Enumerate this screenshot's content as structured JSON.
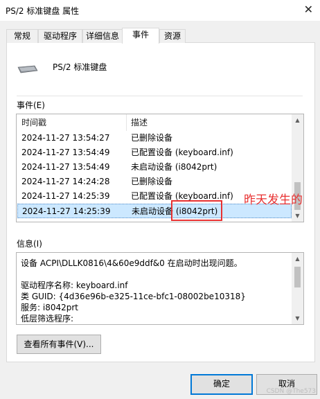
{
  "window": {
    "title": "PS/2 标准键盘 属性",
    "close": "✕"
  },
  "tabs": [
    "常规",
    "驱动程序",
    "详细信息",
    "事件",
    "资源"
  ],
  "device": {
    "name": "PS/2 标准键盘"
  },
  "events": {
    "label": "事件(E)",
    "columns": [
      "时间戳",
      "描述"
    ],
    "rows": [
      {
        "time": "2024-11-27 13:54:27",
        "desc": "已删除设备"
      },
      {
        "time": "2024-11-27 13:54:49",
        "desc": "已配置设备 (keyboard.inf)"
      },
      {
        "time": "2024-11-27 13:54:49",
        "desc": "未启动设备 (i8042prt)"
      },
      {
        "time": "2024-11-27 14:24:28",
        "desc": "已删除设备"
      },
      {
        "time": "2024-11-27 14:25:39",
        "desc": "已配置设备 (keyboard.inf)"
      },
      {
        "time": "2024-11-27 14:25:39",
        "desc": "未启动设备 (i8042prt)"
      }
    ],
    "selected_index": 5
  },
  "annotation": {
    "text": "昨天发生的",
    "color": "#e83131"
  },
  "info": {
    "label": "信息(I)",
    "lines": [
      "设备 ACPI\\DLLK0816\\4&60e9ddf&0 在启动时出现问题。",
      "",
      "驱动程序名称: keyboard.inf",
      "类 GUID: {4d36e96b-e325-11ce-bfc1-08002be10318}",
      "服务: i8042prt",
      "低层筛选程序:"
    ]
  },
  "buttons": {
    "view_all": "查看所有事件(V)...",
    "ok": "确定",
    "cancel": "取消"
  },
  "watermark": "CSDN @The573",
  "colors": {
    "accent": "#0078d7",
    "selection": "#cce8ff",
    "annotation": "#e83131"
  }
}
